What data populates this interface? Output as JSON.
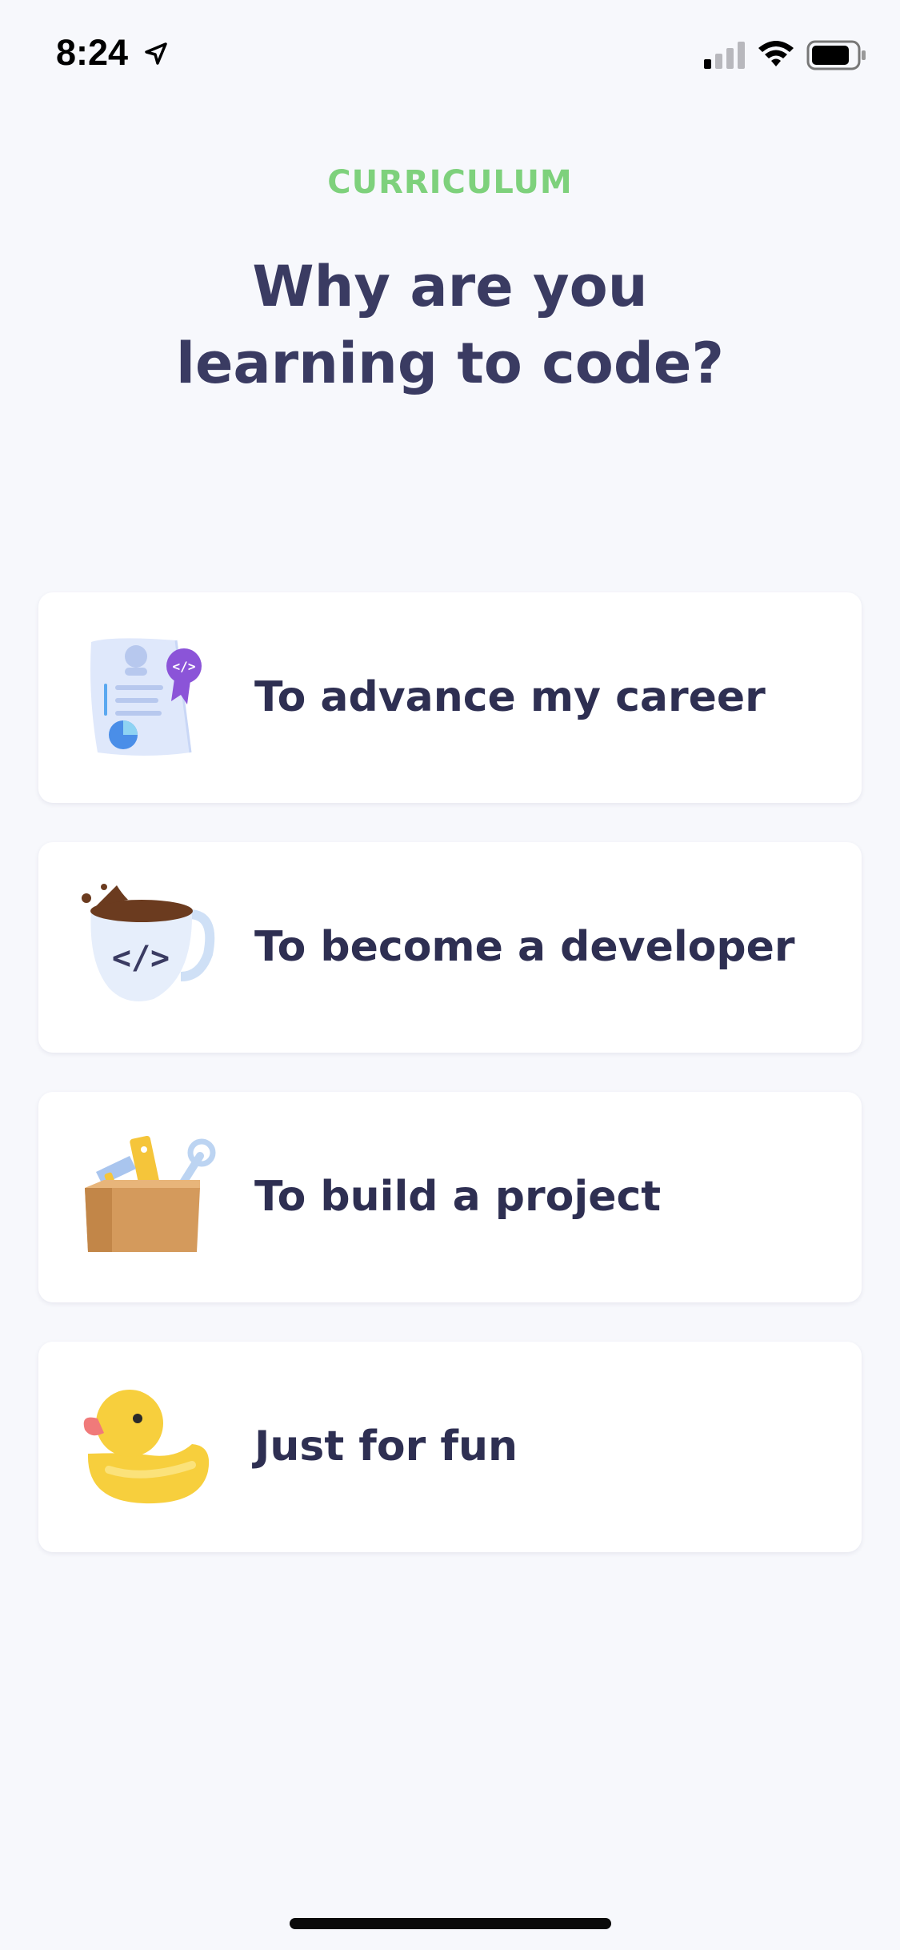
{
  "status_bar": {
    "time": "8:24",
    "icons": [
      "location-arrow-icon",
      "cellular-signal-icon",
      "wifi-icon",
      "battery-icon"
    ]
  },
  "header": {
    "section_label": "CURRICULUM",
    "title": "Why are you learning to code?"
  },
  "options": [
    {
      "label": "To advance my career",
      "icon": "certificate-icon"
    },
    {
      "label": "To become a developer",
      "icon": "coffee-mug-icon"
    },
    {
      "label": "To build a project",
      "icon": "toolbox-icon"
    },
    {
      "label": "Just for fun",
      "icon": "rubber-duck-icon"
    }
  ],
  "colors": {
    "background": "#f7f8fc",
    "accent_green": "#7ed17c",
    "title_text": "#3a3b62",
    "card_text": "#2e2f52",
    "card_background": "#ffffff"
  }
}
